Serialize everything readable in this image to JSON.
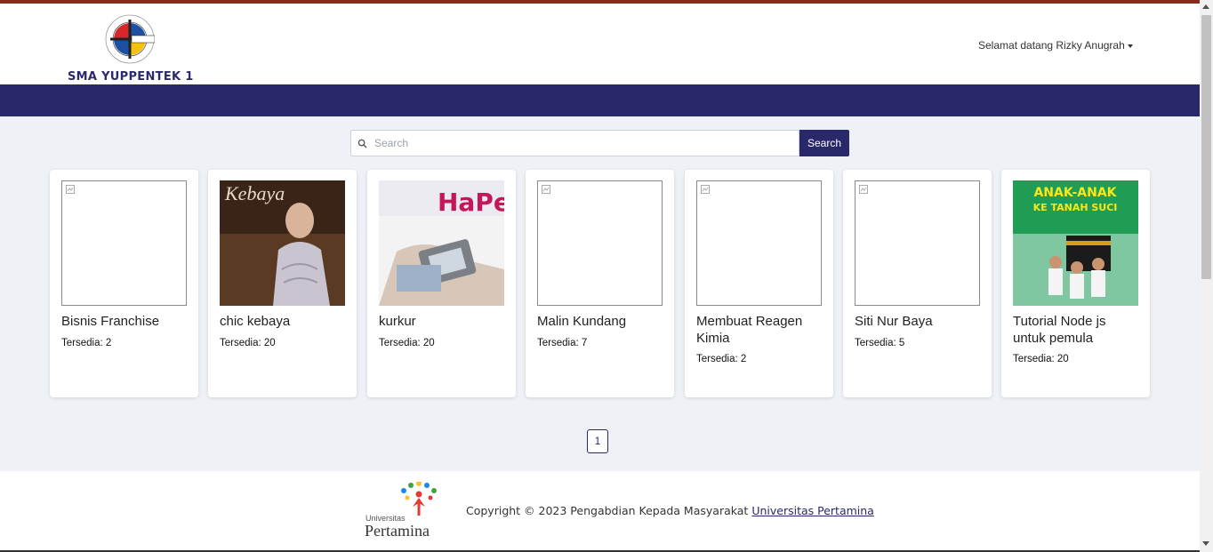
{
  "header": {
    "school_name": "SMA YUPPENTEK 1",
    "logo_icon": "yuppentek-emblem-icon",
    "user_menu_label": "Selamat datang Rizky Anugrah"
  },
  "search": {
    "placeholder": "Search",
    "value": "",
    "button_label": "Search"
  },
  "books": [
    {
      "title": "Bisnis Franchise",
      "stock": "Tersedia: 2",
      "cover": "broken-image-icon"
    },
    {
      "title": "chic kebaya",
      "stock": "Tersedia: 20",
      "cover": "kebaya-cover"
    },
    {
      "title": "kurkur",
      "stock": "Tersedia: 20",
      "cover": "hape-cover"
    },
    {
      "title": "Malin Kundang",
      "stock": "Tersedia: 7",
      "cover": "broken-image-icon"
    },
    {
      "title": "Membuat Reagen Kimia",
      "stock": "Tersedia: 2",
      "cover": "broken-image-icon"
    },
    {
      "title": "Siti Nur Baya",
      "stock": "Tersedia: 5",
      "cover": "broken-image-icon"
    },
    {
      "title": "Tutorial Node js untuk pemula",
      "stock": "Tersedia: 20",
      "cover": "anak-anak-cover"
    }
  ],
  "pagination": {
    "pages": [
      "1"
    ],
    "current": "1"
  },
  "footer": {
    "logo_small": "Universitas",
    "logo_big": "Pertamina",
    "copyright_text": "Copyright © 2023 Pengabdian Kepada Masyarakat",
    "link_text": "Universitas Pertamina"
  },
  "colors": {
    "primary": "#29286a",
    "top_bar": "#8b2a1a",
    "background": "#eef1f5"
  }
}
